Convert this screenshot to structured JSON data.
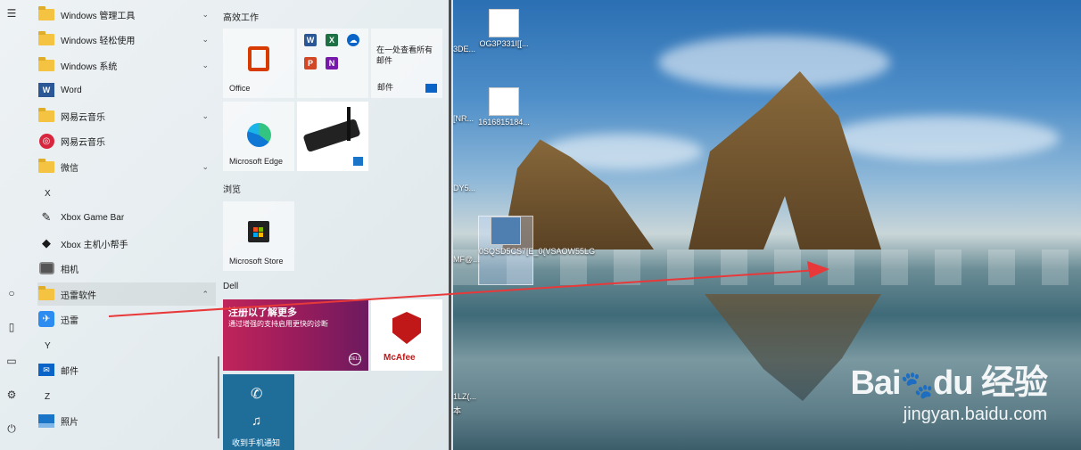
{
  "start_menu": {
    "rail": {
      "items": [
        {
          "name": "hamburger-icon",
          "glyph": "☰"
        },
        {
          "name": "user-icon",
          "glyph": "○"
        },
        {
          "name": "documents-icon",
          "glyph": "▯"
        },
        {
          "name": "pictures-icon",
          "glyph": "▭"
        },
        {
          "name": "settings-icon",
          "glyph": "⚙"
        },
        {
          "name": "power-icon",
          "glyph": "⏻"
        }
      ]
    },
    "app_list": {
      "items": [
        {
          "label": "Windows 管理工具",
          "icon": "folder-icon",
          "chevron": "⌄"
        },
        {
          "label": "Windows 轻松使用",
          "icon": "folder-icon",
          "chevron": "⌄"
        },
        {
          "label": "Windows 系统",
          "icon": "folder-icon",
          "chevron": "⌄"
        },
        {
          "label": "Word",
          "icon": "word-icon"
        },
        {
          "label": "网易云音乐",
          "icon": "folder-icon",
          "chevron": "⌄"
        },
        {
          "label": "网易云音乐",
          "icon": "netease-music-icon"
        },
        {
          "label": "微信",
          "icon": "folder-icon",
          "chevron": "⌄"
        },
        {
          "letter": "X"
        },
        {
          "label": "Xbox Game Bar",
          "icon": "xbox-game-bar-icon"
        },
        {
          "label": "Xbox 主机小帮手",
          "icon": "xbox-companion-icon"
        },
        {
          "label": "相机",
          "icon": "camera-icon"
        },
        {
          "label": "迅雷软件",
          "icon": "folder-icon",
          "chevron": "⌃"
        },
        {
          "label": "迅雷",
          "icon": "xunlei-icon"
        },
        {
          "letter": "Y"
        },
        {
          "label": "邮件",
          "icon": "mail-icon"
        },
        {
          "letter": "Z"
        },
        {
          "label": "照片",
          "icon": "photos-icon"
        }
      ]
    },
    "tiles": {
      "groups": [
        {
          "title": "高效工作"
        },
        {
          "title": "浏览"
        },
        {
          "title": "Dell"
        }
      ],
      "office_label": "Office",
      "mail_tile_text": "在一处查看所有邮件",
      "mail_label": "邮件",
      "edge_label": "Microsoft Edge",
      "store_label": "Microsoft Store",
      "dell_headline": "注册以了解更多",
      "dell_sub": "通过增强的支持启用更快的诊断",
      "dell_logo": "DELL",
      "mcafee_label": "McAfee",
      "phone_label": "收到手机通知"
    }
  },
  "desktop": {
    "icons": [
      {
        "label": "OG3P331I[[..."
      },
      {
        "label": "1616815184..."
      },
      {
        "label": "0SQSD5CS7[E_0{VSAOW55LG"
      }
    ],
    "edge_labels": [
      "3DE...",
      "[NR...",
      "DY5...",
      "MF@...",
      "1LZ(...",
      "本"
    ]
  },
  "watermark": {
    "brand": "Bai",
    "brand2": "du",
    "brand_cn": "经验",
    "url": "jingyan.baidu.com"
  },
  "colors": {
    "arrow": "#e8393a",
    "accent": "#0078d4"
  }
}
